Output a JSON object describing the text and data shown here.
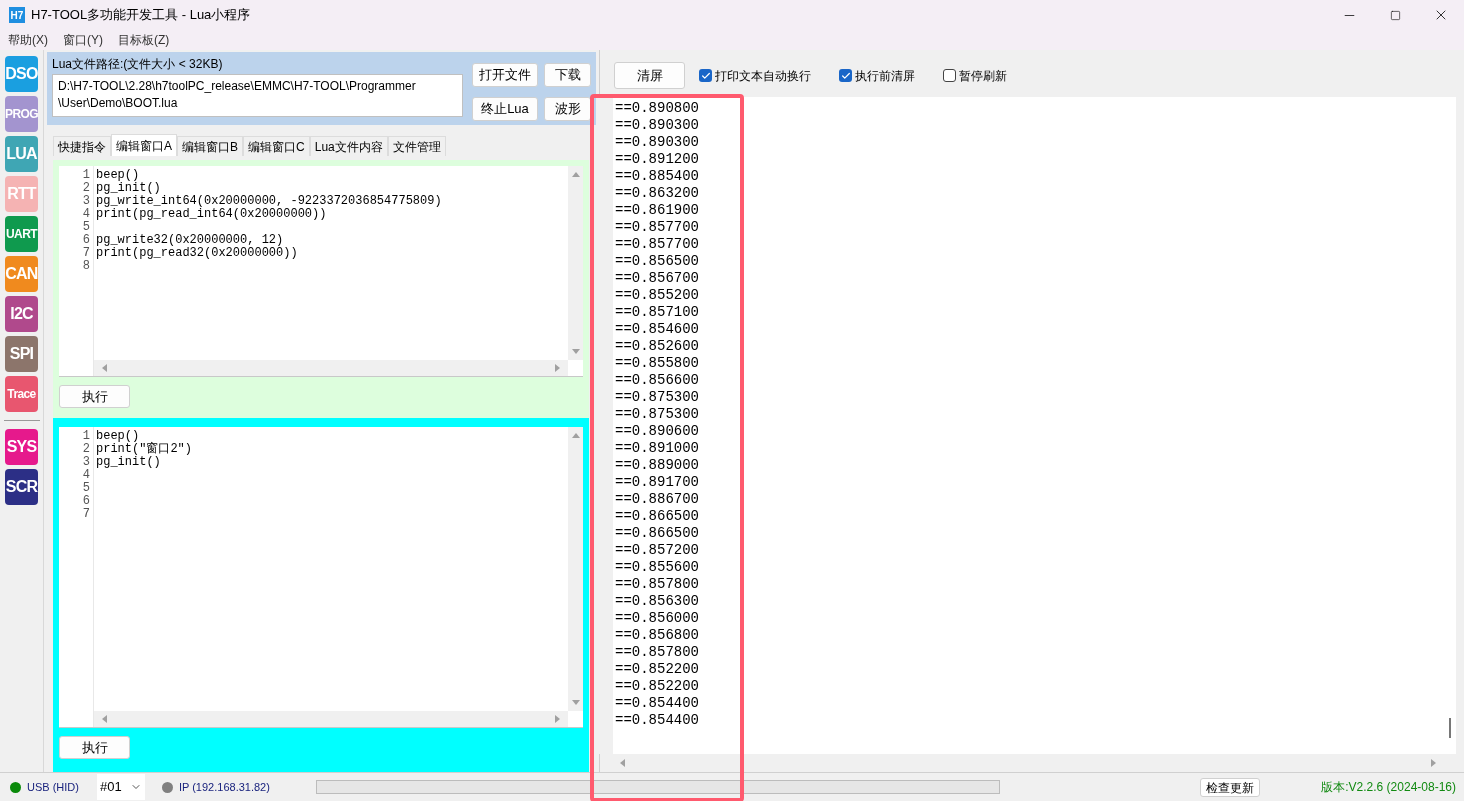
{
  "window": {
    "title": "H7-TOOL多功能开发工具 - Lua小程序",
    "app_icon": "H7"
  },
  "menu": [
    "帮助(X)",
    "窗口(Y)",
    "目标板(Z)"
  ],
  "sidebar": [
    {
      "label": "DSO",
      "color": "#1a9fe0"
    },
    {
      "label": "PROG",
      "color": "#a394cf"
    },
    {
      "label": "LUA",
      "color": "#3fa6b4"
    },
    {
      "label": "RTT",
      "color": "#f5b3b3"
    },
    {
      "label": "UART",
      "color": "#0f9a4e"
    },
    {
      "label": "CAN",
      "color": "#f08a1e"
    },
    {
      "label": "I2C",
      "color": "#b0498c"
    },
    {
      "label": "SPI",
      "color": "#8c756b"
    },
    {
      "label": "Trace",
      "color": "#e8566f"
    },
    {
      "label": "SYS",
      "color": "#e6198c"
    },
    {
      "label": "SCR",
      "color": "#2c2f86"
    }
  ],
  "file_panel": {
    "label": "Lua文件路径:(文件大小 < 32KB)",
    "path_lines": [
      "D:\\H7-TOOL\\2.28\\h7toolPC_release\\EMMC\\H7-TOOL\\Programmer",
      "\\User\\Demo\\BOOT.lua"
    ],
    "buttons": [
      "打开文件",
      "下载",
      "终止Lua",
      "波形"
    ]
  },
  "tabs": [
    {
      "label": "快捷指令",
      "selected": false
    },
    {
      "label": "编辑窗口A",
      "selected": true
    },
    {
      "label": "编辑窗口B",
      "selected": false
    },
    {
      "label": "编辑窗口C",
      "selected": false
    },
    {
      "label": "Lua文件内容",
      "selected": false
    },
    {
      "label": "文件管理",
      "selected": false
    }
  ],
  "editors": [
    {
      "color": "#ddfedd",
      "run_button": "执行",
      "lines": [
        {
          "number": "1",
          "code": "beep()"
        },
        {
          "number": "2",
          "code": "pg_init()"
        },
        {
          "number": "3",
          "code": "pg_write_int64(0x20000000, -9223372036854775809)"
        },
        {
          "number": "4",
          "code": "print(pg_read_int64(0x20000000))"
        },
        {
          "number": "5"
        },
        {
          "number": "6",
          "code": "pg_write32(0x20000000, 12)"
        },
        {
          "number": "7",
          "code": "print(pg_read32(0x20000000))"
        },
        {
          "number": "8"
        }
      ]
    },
    {
      "color": "#00ffff",
      "run_button": "执行",
      "lines": [
        {
          "number": "1",
          "code": "beep()"
        },
        {
          "number": "2",
          "code": "print(\"窗口2\")"
        },
        {
          "number": "3",
          "code": "pg_init()"
        },
        {
          "number": "4"
        },
        {
          "number": "5"
        },
        {
          "number": "6"
        },
        {
          "number": "7"
        }
      ]
    }
  ],
  "output": {
    "clear_button": "清屏",
    "checkboxes": [
      {
        "label": "打印文本自动换行",
        "checked": true
      },
      {
        "label": "执行前清屏",
        "checked": true
      },
      {
        "label": "暂停刷新",
        "checked": false
      }
    ],
    "lines": [
      "==0.890800",
      "==0.890300",
      "==0.890300",
      "==0.891200",
      "==0.885400",
      "==0.863200",
      "==0.861900",
      "==0.857700",
      "==0.857700",
      "==0.856500",
      "==0.856700",
      "==0.855200",
      "==0.857100",
      "==0.854600",
      "==0.852600",
      "==0.855800",
      "==0.856600",
      "==0.875300",
      "==0.875300",
      "==0.890600",
      "==0.891000",
      "==0.889000",
      "==0.891700",
      "==0.886700",
      "==0.866500",
      "==0.866500",
      "==0.857200",
      "==0.855600",
      "==0.857800",
      "==0.856300",
      "==0.856000",
      "==0.856800",
      "==0.857800",
      "==0.852200",
      "==0.852200",
      "==0.854400",
      "==0.854400"
    ]
  },
  "status_bar": {
    "usb": {
      "label": "USB (HID)",
      "connected": true
    },
    "device": "#01",
    "ip": {
      "label": "IP (192.168.31.82)",
      "connected": false
    },
    "progress": {
      "level": 0
    },
    "update_button": "检查更新",
    "version": "版本:V2.2.6 (2024-08-16)"
  }
}
